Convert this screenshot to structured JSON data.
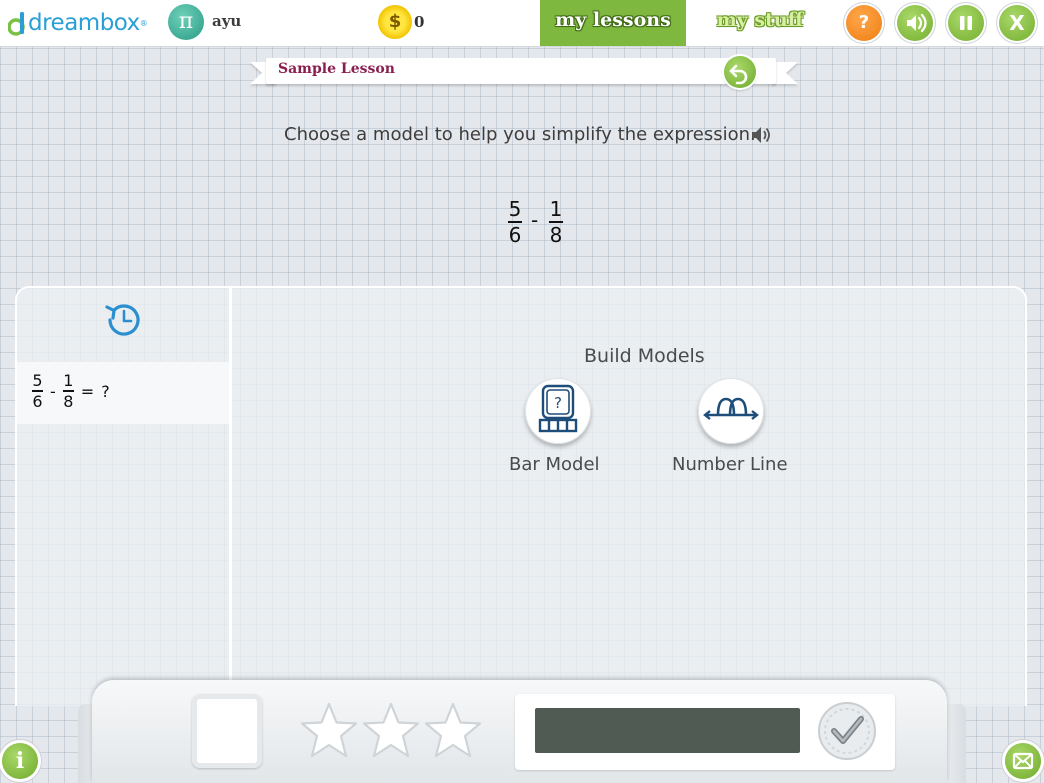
{
  "header": {
    "logo_text": "dreambox",
    "logo_tm": "®",
    "avatar_symbol": "π",
    "username": "ayu",
    "coin_symbol": "$",
    "coin_count": "0",
    "nav_lessons": "my lessons",
    "nav_stuff": "my stuff",
    "help_label": "?",
    "close_label": "X"
  },
  "lesson": {
    "title": "Sample Lesson",
    "prompt": "Choose a model to help you simplify the expression.",
    "expression": {
      "a_num": "5",
      "a_den": "6",
      "operator": "-",
      "b_num": "1",
      "b_den": "8"
    }
  },
  "history": {
    "expr": {
      "a_num": "5",
      "a_den": "6",
      "operator": "-",
      "b_num": "1",
      "b_den": "8",
      "equals": "=",
      "unknown": "?"
    }
  },
  "models": {
    "title": "Build Models",
    "options": [
      {
        "label": "Bar Model",
        "icon": "bar-model-icon"
      },
      {
        "label": "Number Line",
        "icon": "number-line-icon"
      }
    ]
  },
  "tray": {
    "stars_filled": 0,
    "stars_total": 3,
    "info_label": "i"
  },
  "colors": {
    "brand_blue": "#2a9fd6",
    "nav_green": "#7fb83f",
    "help_orange": "#ee7d12",
    "lesson_title": "#8a1f4f",
    "icon_navy": "#1f4d7a"
  }
}
